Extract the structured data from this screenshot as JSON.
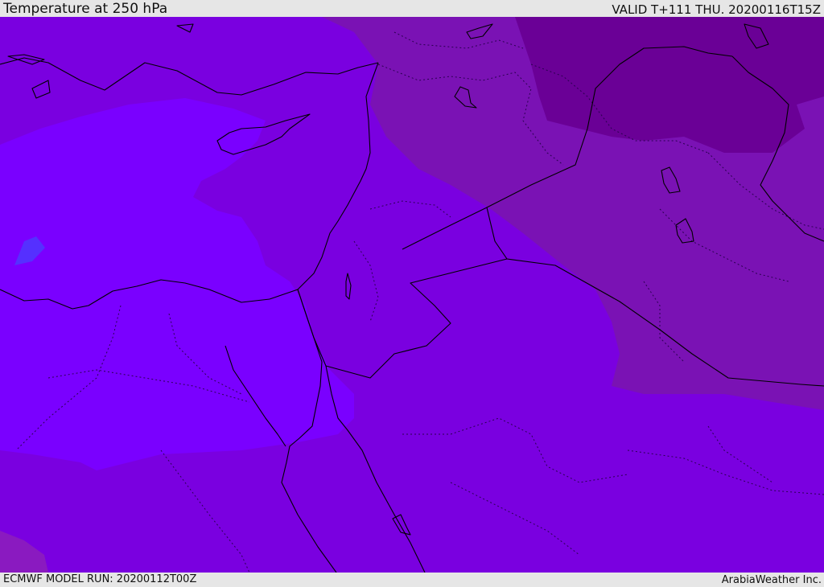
{
  "header": {
    "title": "Temperature at 250 hPa",
    "valid_time": "VALID T+111 THU. 20200116T15Z"
  },
  "footer": {
    "model_run": "ECMWF MODEL RUN: 20200112T00Z",
    "credit": "ArabiaWeather Inc."
  },
  "colors": {
    "background_band": "#e6e6e6",
    "temp_band_warmest": "#7a00ff",
    "temp_band_light": "#8200f0",
    "temp_band_mid": "#7a00e0",
    "temp_band_cold": "#7a12b4",
    "temp_band_coldest": "#6a0096",
    "temp_spot_bluish": "#5530ff",
    "coastline": "#000000"
  }
}
